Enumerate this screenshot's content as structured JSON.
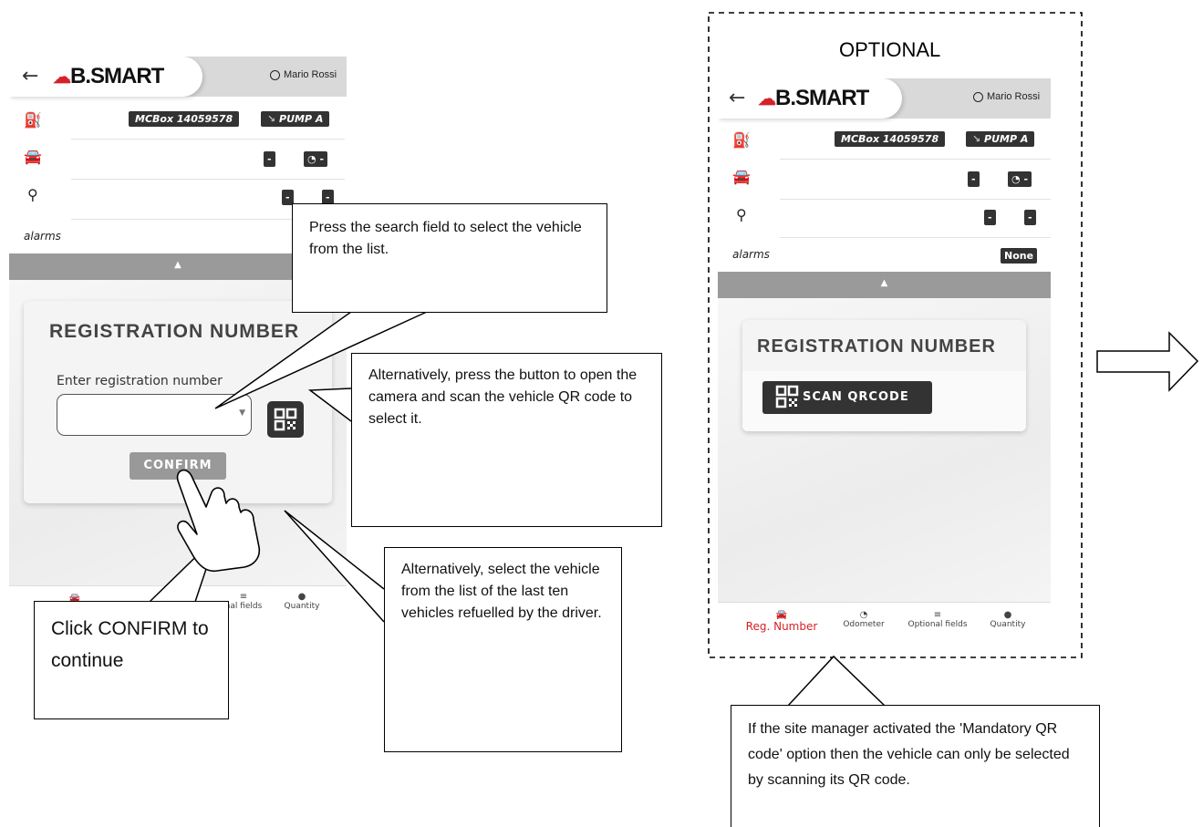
{
  "left_screen": {
    "back_icon": "back-arrow-icon",
    "logo_text": "B.SMART",
    "user_name": "Mario Rossi",
    "device_tag": "MCBox 14059578",
    "pump_tag": "PUMP A",
    "vehicle_tag_1": "-",
    "vehicle_tag_2": "-",
    "driver_tag_1": "-",
    "driver_tag_2": "-",
    "alarms_label": "alarms",
    "collapse_icon": "▲",
    "card_title": "REGISTRATION NUMBER",
    "input_label": "Enter registration number",
    "confirm_label": "CONFIRM",
    "nav": {
      "optional_partial": "nal fields",
      "quantity": "Quantity"
    }
  },
  "right_screen": {
    "optional_label": "OPTIONAL",
    "logo_text": "B.SMART",
    "user_name": "Mario Rossi",
    "device_tag": "MCBox 14059578",
    "pump_tag": "PUMP A",
    "vehicle_tag_1": "-",
    "vehicle_tag_2": "-",
    "driver_tag_1": "-",
    "driver_tag_2": "-",
    "alarms_label": "alarms",
    "alarms_value": "None",
    "collapse_icon": "▲",
    "card_title": "REGISTRATION NUMBER",
    "scan_label": "SCAN QRCODE",
    "nav": {
      "reg_number": "Reg. Number",
      "odometer": "Odometer",
      "optional_fields": "Optional fields",
      "quantity": "Quantity"
    }
  },
  "callouts": {
    "search": "Press the search field to select the vehicle from the list.",
    "qr": "Alternatively, press the button to open the camera and scan the vehicle QR code to select it.",
    "list": "Alternatively, select the vehicle from the list of the last ten vehicles refuelled by the driver.",
    "confirm": "Click CONFIRM to continue",
    "mandatory": "If the site manager activated the 'Mandatory QR code' option then the vehicle can only be selected by scanning its QR code."
  },
  "colors": {
    "brand_red": "#d6202a",
    "tag_dark": "#333333",
    "collapse_gray": "#9a9a9a"
  }
}
